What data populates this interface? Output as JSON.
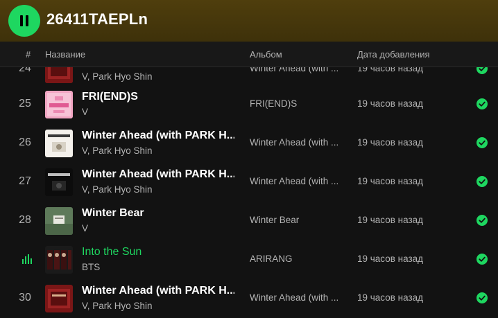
{
  "header": {
    "title": "26411TAEPLn",
    "play_button_state": "pause-icon",
    "accent_color": "#1ed760"
  },
  "columns": {
    "number": "#",
    "title": "Название",
    "album": "Альбом",
    "date_added": "Дата добавления"
  },
  "tracks": [
    {
      "number": "24",
      "title": "",
      "artist": "V, Park Hyo Shin",
      "album": "Winter Ahead (with ...",
      "date_added": "19 часов назад",
      "added": true
    },
    {
      "number": "25",
      "title": "FRI(END)S",
      "artist": "V",
      "album": "FRI(END)S",
      "date_added": "19 часов назад",
      "added": true
    },
    {
      "number": "26",
      "title": "Winter Ahead (with PARK H...",
      "artist": "V, Park Hyo Shin",
      "album": "Winter Ahead (with ...",
      "date_added": "19 часов назад",
      "added": true
    },
    {
      "number": "27",
      "title": "Winter Ahead (with PARK H...",
      "artist": "V, Park Hyo Shin",
      "album": "Winter Ahead (with ...",
      "date_added": "19 часов назад",
      "added": true
    },
    {
      "number": "28",
      "title": "Winter Bear",
      "artist": "V",
      "album": "Winter Bear",
      "date_added": "19 часов назад",
      "added": true
    },
    {
      "number": "",
      "title": "Into the Sun",
      "artist": "BTS",
      "album": "ARIRANG",
      "date_added": "19 часов назад",
      "added": true,
      "now_playing": true
    },
    {
      "number": "30",
      "title": "Winter Ahead (with PARK H...",
      "artist": "V, Park Hyo Shin",
      "album": "Winter Ahead (with ...",
      "date_added": "19 часов назад",
      "added": true
    }
  ]
}
